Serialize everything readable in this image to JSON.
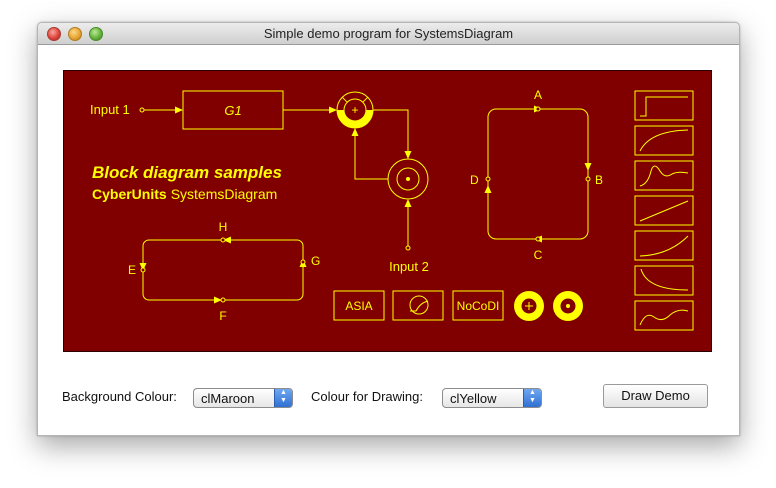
{
  "window": {
    "title": "Simple demo program for SystemsDiagram"
  },
  "diagram": {
    "bg_color": "#800000",
    "draw_color": "#FFFF00",
    "heading": "Block diagram samples",
    "brand_bold": "CyberUnits",
    "brand_rest": "SystemsDiagram",
    "input1": "Input 1",
    "input2": "Input 2",
    "block_g1": "G1",
    "sum_symbol": "+",
    "points_right": {
      "a": "A",
      "b": "B",
      "c": "C",
      "d": "D"
    },
    "points_left": {
      "h": "H",
      "g": "G",
      "f": "F",
      "e": "E"
    },
    "box_asia": "ASIA",
    "box_nocodi": "NoCoDI",
    "icons": [
      "step-response-icon",
      "pt1-response-icon",
      "pt2-response-icon",
      "ramp-response-icon",
      "parabola-response-icon",
      "decay-response-icon",
      "oscillation-response-icon"
    ]
  },
  "controls": {
    "bg_label": "Background Colour:",
    "bg_value": "clMaroon",
    "draw_label": "Colour for Drawing:",
    "draw_value": "clYellow",
    "demo_button": "Draw Demo"
  }
}
